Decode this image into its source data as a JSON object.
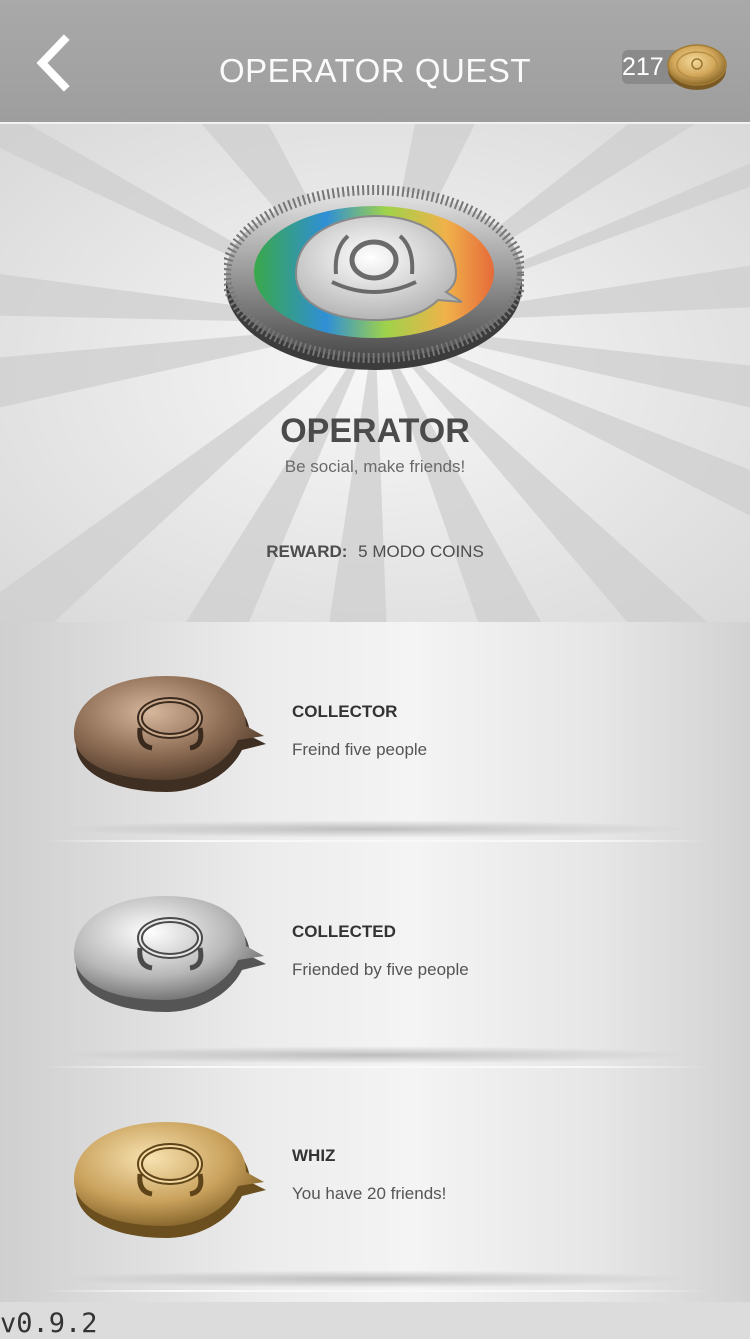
{
  "header": {
    "title": "OPERATOR QUEST",
    "coin_count": "217",
    "back_icon": "chevron-left-icon",
    "coin_icon": "coin-icon"
  },
  "quest": {
    "name": "OPERATOR",
    "description": "Be social, make friends!",
    "reward_label": "REWARD:",
    "reward_value": "5 MODO COINS"
  },
  "achievements": [
    {
      "title": "COLLECTOR",
      "description": "Freind five people",
      "tier": "bronze",
      "color": "#8b6a52"
    },
    {
      "title": "COLLECTED",
      "description": "Friended by five people",
      "tier": "silver",
      "color": "#b8b8b8"
    },
    {
      "title": "WHIZ",
      "description": "You have 20 friends!",
      "tier": "gold",
      "color": "#c9a15c"
    }
  ],
  "version": "v0.9.2",
  "colors": {
    "header_bg": "#a3a3a3",
    "title_text": "#fafafa",
    "quest_name": "#4b4b4b"
  }
}
